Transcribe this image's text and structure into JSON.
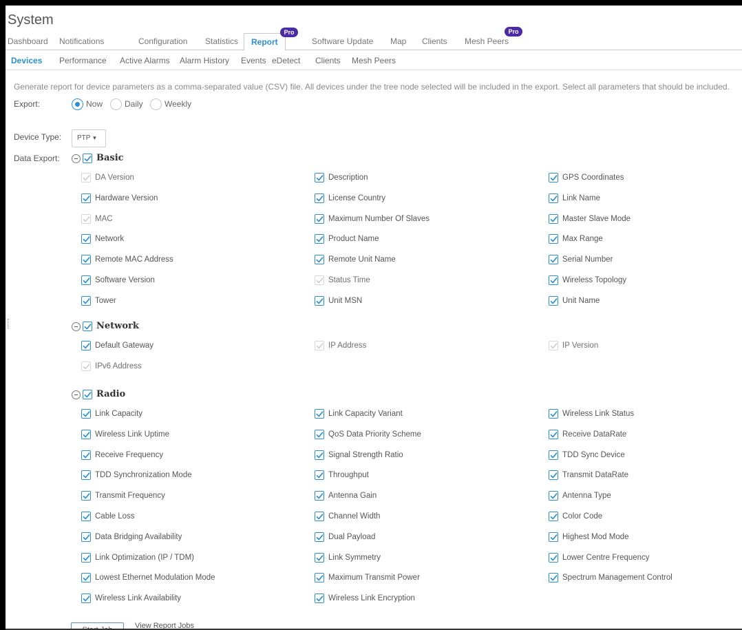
{
  "page_title": "System",
  "main_tabs": [
    {
      "label": "Dashboard"
    },
    {
      "label": "Notifications"
    },
    {
      "label": "Configuration"
    },
    {
      "label": "Statistics"
    },
    {
      "label": "Report",
      "badge": "Pro",
      "active": true
    },
    {
      "label": "Software Update"
    },
    {
      "label": "Map"
    },
    {
      "label": "Clients"
    },
    {
      "label": "Mesh Peers",
      "badge": "Pro"
    }
  ],
  "sub_tabs": [
    {
      "label": "Devices",
      "active": true
    },
    {
      "label": "Performance"
    },
    {
      "label": "Active Alarms"
    },
    {
      "label": "Alarm History"
    },
    {
      "label": "Events"
    },
    {
      "label": "eDetect"
    },
    {
      "label": "Clients"
    },
    {
      "label": "Mesh Peers"
    }
  ],
  "description": "Generate report for device parameters as a comma-separated value (CSV) file. All devices under the tree node selected will be included in the export. Select all parameters that should be included.",
  "export": {
    "label": "Export:",
    "options": [
      {
        "label": "Now",
        "selected": true
      },
      {
        "label": "Daily",
        "selected": false
      },
      {
        "label": "Weekly",
        "selected": false
      }
    ]
  },
  "device_type": {
    "label": "Device Type:",
    "value": "PTP"
  },
  "data_export": {
    "label": "Data Export:",
    "groups": [
      {
        "title": "Basic",
        "items": [
          {
            "label": "DA Version",
            "checked": true,
            "disabled": true
          },
          {
            "label": "Description",
            "checked": true
          },
          {
            "label": "GPS Coordinates",
            "checked": true
          },
          {
            "label": "Hardware Version",
            "checked": true
          },
          {
            "label": "License Country",
            "checked": true
          },
          {
            "label": "Link Name",
            "checked": true
          },
          {
            "label": "MAC",
            "checked": true,
            "disabled": true
          },
          {
            "label": "Maximum Number Of Slaves",
            "checked": true
          },
          {
            "label": "Master Slave Mode",
            "checked": true
          },
          {
            "label": "Network",
            "checked": true
          },
          {
            "label": "Product Name",
            "checked": true
          },
          {
            "label": "Max Range",
            "checked": true
          },
          {
            "label": "Remote MAC Address",
            "checked": true
          },
          {
            "label": "Remote Unit Name",
            "checked": true
          },
          {
            "label": "Serial Number",
            "checked": true
          },
          {
            "label": "Software Version",
            "checked": true
          },
          {
            "label": "Status Time",
            "checked": true,
            "disabled": true
          },
          {
            "label": "Wireless Topology",
            "checked": true
          },
          {
            "label": "Tower",
            "checked": true
          },
          {
            "label": "Unit MSN",
            "checked": true
          },
          {
            "label": "Unit Name",
            "checked": true
          }
        ]
      },
      {
        "title": "Network",
        "items": [
          {
            "label": "Default Gateway",
            "checked": true
          },
          {
            "label": "IP Address",
            "checked": true,
            "disabled": true
          },
          {
            "label": "IP Version",
            "checked": true,
            "disabled": true
          },
          {
            "label": "IPv6 Address",
            "checked": true,
            "disabled": true
          }
        ]
      },
      {
        "title": "Radio",
        "items": [
          {
            "label": "Link Capacity",
            "checked": true
          },
          {
            "label": "Link Capacity Variant",
            "checked": true
          },
          {
            "label": "Wireless Link Status",
            "checked": true
          },
          {
            "label": "Wireless Link Uptime",
            "checked": true
          },
          {
            "label": "QoS Data Priority Scheme",
            "checked": true
          },
          {
            "label": "Receive DataRate",
            "checked": true
          },
          {
            "label": "Receive Frequency",
            "checked": true
          },
          {
            "label": "Signal Strength Ratio",
            "checked": true
          },
          {
            "label": "TDD Sync Device",
            "checked": true
          },
          {
            "label": "TDD Synchronization Mode",
            "checked": true
          },
          {
            "label": "Throughput",
            "checked": true
          },
          {
            "label": "Transmit DataRate",
            "checked": true
          },
          {
            "label": "Transmit Frequency",
            "checked": true
          },
          {
            "label": "Antenna Gain",
            "checked": true
          },
          {
            "label": "Antenna Type",
            "checked": true
          },
          {
            "label": "Cable Loss",
            "checked": true
          },
          {
            "label": "Channel Width",
            "checked": true
          },
          {
            "label": "Color Code",
            "checked": true
          },
          {
            "label": "Data Bridging Availability",
            "checked": true
          },
          {
            "label": "Dual Payload",
            "checked": true
          },
          {
            "label": "Highest Mod Mode",
            "checked": true
          },
          {
            "label": "Link Optimization (IP / TDM)",
            "checked": true
          },
          {
            "label": "Link Symmetry",
            "checked": true
          },
          {
            "label": "Lower Centre Frequency",
            "checked": true
          },
          {
            "label": "Lowest Ethernet Modulation Mode",
            "checked": true
          },
          {
            "label": "Maximum Transmit Power",
            "checked": true
          },
          {
            "label": "Spectrum Management Control",
            "checked": true
          },
          {
            "label": "Wireless Link Availability",
            "checked": true
          },
          {
            "label": "Wireless Link Encryption",
            "checked": true
          }
        ]
      }
    ]
  },
  "actions": {
    "start_job": "Start Job",
    "view_jobs": "View Report Jobs"
  },
  "colors": {
    "accent": "#2c8fd1",
    "pro_badge": "#4a2aa8"
  }
}
